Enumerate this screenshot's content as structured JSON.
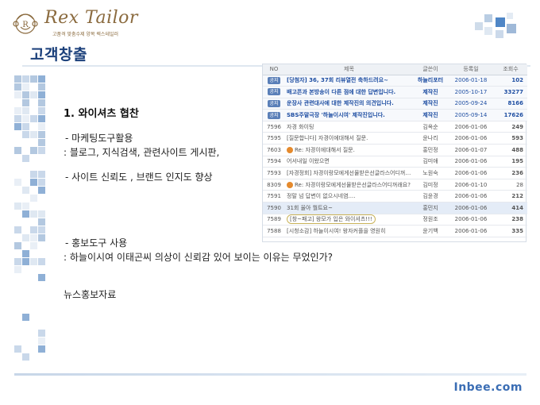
{
  "logo": {
    "name": "Rex Tailor",
    "tagline": "고품격 맞춤수제 양복 렉스테일러",
    "colors": {
      "gold": "#8a6a3e"
    }
  },
  "page": {
    "title": "고객창출",
    "brand": "Inbee.com"
  },
  "content": {
    "heading": "1. 와이셔츠 협찬",
    "line1": "- 마케팅도구활용",
    "line2": ": 블로그, 지식검색, 관련사이트 게시판,",
    "line3": "- 사이트 신뢰도 , 브랜드 인지도 향상",
    "line4": "- 홍보도구 사용",
    "line5": ": 하늘이시여 이태곤씨 의상이 신뢰감 있어 보이는 이유는 무었인가?",
    "line6": "뉴스홍보자료"
  },
  "board": {
    "headers": [
      "NO",
      "제목",
      "글쓴이",
      "등록일",
      "조회수"
    ],
    "rows": [
      {
        "no": "공지",
        "title": "[당첨자] 36, 37회 리뷰열전 축하드려요~",
        "author": "하늘리포터",
        "date": "2006-01-18",
        "count": "102"
      },
      {
        "no": "공지",
        "title": "배고픈과 본방송이 다른 점에 대한 답변입니다.",
        "author": "제작진",
        "date": "2005-10-17",
        "count": "33277"
      },
      {
        "no": "공지",
        "title": "운장사 관련대사에 대한 제작진의 의견입니다.",
        "author": "제작진",
        "date": "2005-09-24",
        "count": "8166"
      },
      {
        "no": "공지",
        "title": "SBS주말극장 '하늘이시여' 제작진입니다.",
        "author": "제작진",
        "date": "2005-09-14",
        "count": "17626"
      },
      {
        "no": "7596",
        "title": "자경 화이팅",
        "author": "김옥순",
        "date": "2006-01-06",
        "count": "249"
      },
      {
        "no": "7595",
        "title": "[질문합니다] 자경이에대해서 질문.",
        "author": "윤나리",
        "date": "2006-01-06",
        "count": "593"
      },
      {
        "no": "7603",
        "title": "Re: 자경이에대해서 질문.",
        "author": "홍민정",
        "date": "2006-01-07",
        "count": "488"
      },
      {
        "no": "7594",
        "title": "어서내일 이왔으면",
        "author": "김미애",
        "date": "2006-01-06",
        "count": "195"
      },
      {
        "no": "7593",
        "title": "[자경정회] 자경이랑모에게선물받은선글라스어디꺼래요?",
        "author": "노원숙",
        "date": "2006-01-06",
        "count": "236"
      },
      {
        "no": "8309",
        "title": "Re: 자경이랑모에게선물받은선글라스어디꺼래요?",
        "author": "김미정",
        "date": "2006-01-10",
        "count": "28"
      },
      {
        "no": "7591",
        "title": "정말 넘 답변이 없으시네염....",
        "author": "김윤경",
        "date": "2006-01-06",
        "count": "212"
      },
      {
        "no": "7590",
        "title": "31회 율아 뭘트요~",
        "author": "홍민지",
        "date": "2006-01-06",
        "count": "414"
      },
      {
        "no": "7589",
        "title": "[창~패고] 왕모가 입은 와이셔츠!!!",
        "author": "정원조",
        "date": "2006-01-06",
        "count": "238"
      },
      {
        "no": "7588",
        "title": "[시청소감] 하늘이시여! 왕자커플을 영원히",
        "author": "윤기백",
        "date": "2006-01-06",
        "count": "335"
      }
    ],
    "colors": {
      "notice": "#1e4ea2",
      "header_bg": "#eef1f5"
    }
  }
}
